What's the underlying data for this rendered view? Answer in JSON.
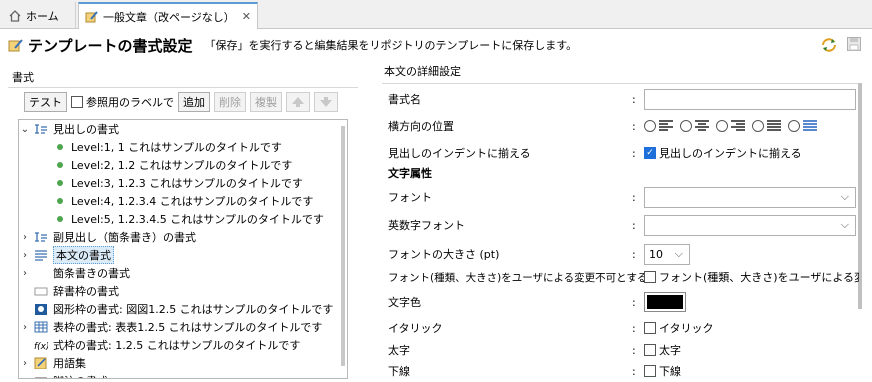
{
  "tabs": [
    {
      "label": "ホーム",
      "icon": "home-icon"
    },
    {
      "label": "一般文章（改ページなし）",
      "icon": "edit-doc-icon",
      "close": "✕"
    }
  ],
  "header": {
    "title": "テンプレートの書式設定",
    "description": "「保存」を実行すると編集結果をリポジトリのテンプレートに保存します。"
  },
  "left": {
    "section_title": "書式",
    "toolbar": {
      "test": "テスト",
      "ref_label": "参照用のラベルで",
      "add": "追加",
      "delete": "削除",
      "copy": "複製"
    },
    "tree": [
      {
        "label": "見出しの書式",
        "exp": "v",
        "icon": "heading-icon"
      },
      {
        "label": "Level:1, 1 これはサンプルのタイトルです",
        "child": true
      },
      {
        "label": "Level:2, 1.2 これはサンプルのタイトルです",
        "child": true
      },
      {
        "label": "Level:3, 1.2.3 これはサンプルのタイトルです",
        "child": true
      },
      {
        "label": "Level:4, 1.2.3.4 これはサンプルのタイトルです",
        "child": true
      },
      {
        "label": "Level:5, 1.2.3.4.5 これはサンプルのタイトルです",
        "child": true
      },
      {
        "label": "副見出し（箇条書き）の書式",
        "exp": ">",
        "icon": "heading-icon"
      },
      {
        "label": "本文の書式",
        "exp": ">",
        "icon": "paragraph-icon",
        "selected": true
      },
      {
        "label": "箇条書きの書式",
        "exp": ">",
        "icon": "none"
      },
      {
        "label": "辞書枠の書式",
        "exp": "",
        "icon": "box-icon"
      },
      {
        "label": "図形枠の書式: 図図1.2.5 これはサンプルのタイトルです",
        "exp": "",
        "icon": "figure-icon"
      },
      {
        "label": "表枠の書式: 表表1.2.5 これはサンプルのタイトルです",
        "exp": ">",
        "icon": "table-icon"
      },
      {
        "label": "式枠の書式: 1.2.5 これはサンプルのタイトルです",
        "exp": "",
        "icon": "formula-icon"
      },
      {
        "label": "用語集",
        "exp": ">",
        "icon": "glossary-icon"
      },
      {
        "label": "脚注の書式",
        "exp": "",
        "icon": "footnote-icon"
      }
    ]
  },
  "right": {
    "section_title": "本文の詳細設定",
    "fields": {
      "format_name": "書式名",
      "align": "横方向の位置",
      "indent": "見出しのインデントに揃える",
      "indent_check": "見出しのインデントに揃える",
      "char_attr": "文字属性",
      "font": "フォント",
      "font_en": "英数字フォント",
      "font_size": "フォントの大きさ (pt)",
      "font_size_val": "10",
      "lock": "フォント(種類、大きさ)をユーザによる変更不可とする",
      "lock_check": "フォント(種類、大きさ)をユーザによる変更",
      "color": "文字色",
      "italic": "イタリック",
      "italic_check": "イタリック",
      "bold": "太字",
      "bold_check": "太字",
      "underline": "下線",
      "underline_check": "下線"
    },
    "colon": ":",
    "text_color": "#000000"
  }
}
